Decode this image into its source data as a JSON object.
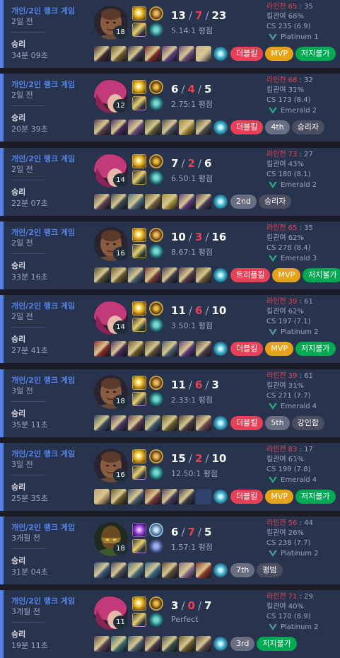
{
  "colors": {
    "card_bg": "#28344e",
    "win_accent": "#5383e8",
    "death_red": "#e84057",
    "mvp_gold": "#e6a218",
    "green": "#00aa53",
    "grey_badge": "#6a6e82"
  },
  "lane_label": "라인전",
  "matches": [
    {
      "queue": "개인/2인 랭크 게임",
      "ago": "2일 전",
      "result": "승리",
      "duration": "34분 09초",
      "champion_icon": "dark-skinned-champion-portrait",
      "level": "18",
      "kills": "13",
      "deaths": "7",
      "assists": "23",
      "ratio": "5.14:1 평점",
      "spells": [
        "flash",
        "smite"
      ],
      "rune": "conqueror",
      "lane_a": "65",
      "lane_b": "35",
      "kp": "킬관여 68%",
      "cs": "CS 235 (6.9)",
      "tier": "Platinum 1",
      "tier_color": "#4e9996",
      "badges": [
        {
          "text": "더블킬",
          "style": "red"
        },
        {
          "text": "MVP",
          "style": "mvp"
        },
        {
          "text": "저지불가",
          "style": "green"
        }
      ],
      "items": [
        "#3a2a34",
        "#6a5a2a",
        "#3a3a48",
        "#7a2a2a",
        "#5a3a7a",
        "#6a4a7a",
        "#c0b090"
      ]
    },
    {
      "queue": "개인/2인 랭크 게임",
      "ago": "2일 전",
      "result": "승리",
      "duration": "20분 39초",
      "champion_icon": "pink-haired-champion-portrait",
      "level": "12",
      "kills": "6",
      "deaths": "4",
      "assists": "5",
      "ratio": "2.75:1 평점",
      "spells": [
        "flash",
        "smite"
      ],
      "rune": "electrocute",
      "lane_a": "68",
      "lane_b": "32",
      "kp": "킬관여 31%",
      "cs": "CS 173 (8.4)",
      "tier": "Emerald 2",
      "tier_color": "#2aa87a",
      "badges": [
        {
          "text": "더블킬",
          "style": "red"
        },
        {
          "text": "4th",
          "style": "grey"
        },
        {
          "text": "승리자",
          "style": "dark"
        }
      ],
      "items": [
        "#5a4050",
        "#4a2a5a",
        "#6a4a7a",
        "#5a5a3a",
        "#4a4a5a",
        "#a08a3a",
        "#4a4a4a"
      ]
    },
    {
      "queue": "개인/2인 랭크 게임",
      "ago": "2일 전",
      "result": "승리",
      "duration": "22분 07초",
      "champion_icon": "pink-haired-champion-portrait",
      "level": "14",
      "kills": "7",
      "deaths": "2",
      "assists": "6",
      "ratio": "6.50:1 평점",
      "spells": [
        "flash",
        "smite"
      ],
      "rune": "electrocute",
      "lane_a": "73",
      "lane_b": "27",
      "kp": "킬관여 43%",
      "cs": "CS 180 (8.1)",
      "tier": "Emerald 2",
      "tier_color": "#2aa87a",
      "badges": [
        {
          "text": "2nd",
          "style": "grey"
        },
        {
          "text": "승리자",
          "style": "dark"
        }
      ],
      "items": [
        "#5a4050",
        "#3a4a4a",
        "#4a6a7a",
        "#6a5a3a",
        "#a08a3a",
        "#5a3a7a",
        "#4a3a5a"
      ]
    },
    {
      "queue": "개인/2인 랭크 게임",
      "ago": "2일 전",
      "result": "승리",
      "duration": "33분 16초",
      "champion_icon": "dark-skinned-champion-portrait",
      "level": "16",
      "kills": "10",
      "deaths": "3",
      "assists": "16",
      "ratio": "8.67:1 평점",
      "spells": [
        "flash",
        "smite"
      ],
      "rune": "conqueror",
      "lane_a": "65",
      "lane_b": "35",
      "kp": "킬관여 62%",
      "cs": "CS 278 (8.4)",
      "tier": "Emerald 3",
      "tier_color": "#2aa87a",
      "badges": [
        {
          "text": "트리플킬",
          "style": "red"
        },
        {
          "text": "MVP",
          "style": "mvp"
        },
        {
          "text": "저지불가",
          "style": "green"
        }
      ],
      "items": [
        "#4a4a3a",
        "#6a5a2a",
        "#4a5a6a",
        "#7a3a3a",
        "#3a3a48",
        "#5a3a4a",
        "#6a5a3a"
      ]
    },
    {
      "queue": "개인/2인 랭크 게임",
      "ago": "2일 전",
      "result": "승리",
      "duration": "27분 41초",
      "champion_icon": "pink-haired-champion-portrait",
      "level": "14",
      "kills": "11",
      "deaths": "6",
      "assists": "10",
      "ratio": "3.50:1 평점",
      "spells": [
        "flash",
        "smite"
      ],
      "rune": "electrocute",
      "lane_a": "39",
      "lane_b": "61",
      "kp": "킬관여 62%",
      "cs": "CS 197 (7.1)",
      "tier": "Platinum 2",
      "tier_color": "#4e9996",
      "badges": [
        {
          "text": "더블킬",
          "style": "red"
        },
        {
          "text": "MVP",
          "style": "mvp"
        },
        {
          "text": "저지불가",
          "style": "green"
        }
      ],
      "items": [
        "#8a2a2a",
        "#4a2a5a",
        "#6a5a2a",
        "#5a4a3a",
        "#4a5a6a",
        "#5a3a7a",
        "#4a3a4a"
      ]
    },
    {
      "queue": "개인/2인 랭크 게임",
      "ago": "3일 전",
      "result": "승리",
      "duration": "35분 11초",
      "champion_icon": "dark-skinned-champion-portrait",
      "level": "18",
      "kills": "11",
      "deaths": "6",
      "assists": "3",
      "ratio": "2.33:1 평점",
      "spells": [
        "flash",
        "smite"
      ],
      "rune": "conqueror",
      "lane_a": "39",
      "lane_b": "61",
      "kp": "킬관여 31%",
      "cs": "CS 271 (7.7)",
      "tier": "Emerald 4",
      "tier_color": "#2aa87a",
      "badges": [
        {
          "text": "더블킬",
          "style": "red"
        },
        {
          "text": "5th",
          "style": "grey"
        },
        {
          "text": "강인함",
          "style": "dark"
        }
      ],
      "items": [
        "#3a4a5a",
        "#4a3a6a",
        "#5a3a4a",
        "#3a5a6a",
        "#6a5a2a",
        "#4a3a3a",
        "#6a4a4a"
      ]
    },
    {
      "queue": "개인/2인 랭크 게임",
      "ago": "3일 전",
      "result": "승리",
      "duration": "25분 35초",
      "champion_icon": "dark-skinned-champion-portrait",
      "level": "16",
      "kills": "15",
      "deaths": "2",
      "assists": "10",
      "ratio": "12.50:1 평점",
      "spells": [
        "flash",
        "smite"
      ],
      "rune": "conqueror",
      "lane_a": "83",
      "lane_b": "17",
      "kp": "킬관여 61%",
      "cs": "CS 199 (7.8)",
      "tier": "Emerald 4",
      "tier_color": "#2aa87a",
      "badges": [
        {
          "text": "더블킬",
          "style": "red"
        },
        {
          "text": "MVP",
          "style": "mvp"
        },
        {
          "text": "저지불가",
          "style": "green"
        }
      ],
      "items": [
        "#c0a070",
        "#6a5a2a",
        "#4a5a6a",
        "#7a3a3a",
        "#4a3a5a",
        "#3a3a48",
        "empty"
      ]
    },
    {
      "queue": "개인/2인 랭크 게임",
      "ago": "3개월 전",
      "result": "승리",
      "duration": "31분 04초",
      "champion_icon": "masked-champion-portrait",
      "level": "18",
      "kills": "6",
      "deaths": "7",
      "assists": "5",
      "ratio": "1.57:1 평점",
      "spells": [
        "ignite-purple",
        "smite"
      ],
      "rune": "first-strike",
      "lane_a": "56",
      "lane_b": "44",
      "kp": "킬관여 26%",
      "cs": "CS 238 (7.7)",
      "tier": "Platinum 2",
      "tier_color": "#4e9996",
      "badges": [
        {
          "text": "7th",
          "style": "grey"
        },
        {
          "text": "평범",
          "style": "dark"
        }
      ],
      "items": [
        "#3a5a7a",
        "#4a4a5a",
        "#4a6a7a",
        "#3a6a8a",
        "#5a4a3a",
        "#8a6a8a",
        "#8a3a2a"
      ]
    },
    {
      "queue": "개인/2인 랭크 게임",
      "ago": "3개월 전",
      "result": "승리",
      "duration": "19분 11초",
      "champion_icon": "pink-haired-champion-portrait",
      "level": "11",
      "kills": "3",
      "deaths": "0",
      "assists": "7",
      "ratio": "Perfect",
      "spells": [
        "flash",
        "smite"
      ],
      "rune": "electrocute",
      "lane_a": "71",
      "lane_b": "29",
      "kp": "킬관여 40%",
      "cs": "CS 170 (8.9)",
      "tier": "Platinum 2",
      "tier_color": "#4e9996",
      "badges": [
        {
          "text": "3rd",
          "style": "grey"
        },
        {
          "text": "저지불가",
          "style": "green"
        }
      ],
      "items": [
        "#5a4050",
        "#3a6a6a",
        "#4a5a6a",
        "#4a3a4a",
        "#3a4a4a",
        "#6a5a2a",
        "#5a4a4a"
      ]
    }
  ]
}
